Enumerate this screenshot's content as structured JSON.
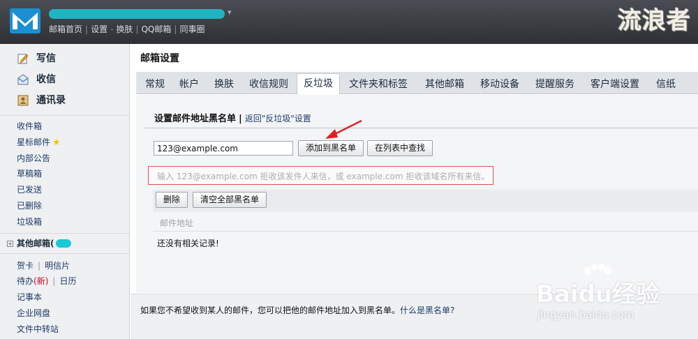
{
  "header": {
    "account_suffix": "▾",
    "links": [
      "邮箱首页",
      "设置",
      "换肤",
      "QQ邮箱",
      "同事圈"
    ],
    "separators": [
      "|",
      "-",
      "|",
      "|"
    ],
    "stamp": "流浪者"
  },
  "sidebar": {
    "primary": [
      {
        "label": "写信",
        "icon": "compose-icon"
      },
      {
        "label": "收信",
        "icon": "inbox-icon"
      },
      {
        "label": "通讯录",
        "icon": "contacts-icon"
      }
    ],
    "folders": [
      "收件箱",
      "星标邮件",
      "内部公告",
      "草稿箱",
      "已发送",
      "已删除",
      "垃圾箱"
    ],
    "other_mail": "其他邮箱(",
    "tools": {
      "card": "贺卡",
      "postcard": "明信片",
      "todo": "待办",
      "todo_new": "(新)",
      "calendar": "日历",
      "notebook": "记事本",
      "netdisk": "企业网盘",
      "transfer": "文件中转站"
    }
  },
  "main": {
    "title": "邮箱设置",
    "tabs": [
      "常规",
      "帐户",
      "换肤",
      "收信规则",
      "反垃圾",
      "文件夹和标签",
      "其他邮箱",
      "移动设备",
      "提醒服务",
      "客户端设置",
      "信纸"
    ],
    "active_tab": "反垃圾",
    "section_title": "设置邮件地址黑名单",
    "section_bar": "|",
    "back_link": "返回\"反垃圾\"设置",
    "email_value": "123@example.com",
    "add_button": "添加到黑名单",
    "search_button": "在列表中查找",
    "hint": "输入 123@example.com 拒收该发件人来信，或 example.com 拒收该域名所有来信。",
    "delete_button": "删除",
    "clear_button": "清空全部黑名单",
    "column_header": "邮件地址",
    "empty_text": "还没有相关记录!",
    "footer_text": "如果您不希望收到某人的邮件，您可以把他的邮件地址加入到黑名单。",
    "footer_link": "什么是黑名单?"
  },
  "watermark": {
    "text": "Baidu经验",
    "sub": "jingyan.baidu.com"
  },
  "colors": {
    "header": "#3a3d42",
    "accent": "#19c9d6",
    "link": "#1e3a66",
    "hint_border": "#d9534f",
    "arrow": "#e02020"
  }
}
